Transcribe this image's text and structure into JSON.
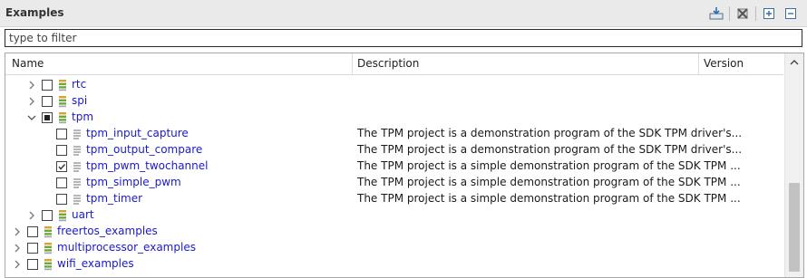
{
  "panel": {
    "title": "Examples",
    "toolbar": {
      "import_icon": "import-icon",
      "remove_icon": "remove-icon",
      "expand_all_icon": "expand-all-icon",
      "collapse_all_icon": "collapse-all-icon"
    }
  },
  "filter": {
    "placeholder": "type to filter",
    "value": ""
  },
  "columns": {
    "name": "Name",
    "description": "Description",
    "version": "Version"
  },
  "rows": [
    {
      "label": "rtc",
      "level": 2,
      "expanded": false,
      "has_children": true,
      "checked": false,
      "partial": false,
      "icon": "stack-icon",
      "description": ""
    },
    {
      "label": "spi",
      "level": 2,
      "expanded": false,
      "has_children": true,
      "checked": false,
      "partial": false,
      "icon": "stack-icon",
      "description": ""
    },
    {
      "label": "tpm",
      "level": 2,
      "expanded": true,
      "has_children": true,
      "checked": false,
      "partial": true,
      "icon": "stack-icon",
      "description": ""
    },
    {
      "label": "tpm_input_capture",
      "level": 3,
      "has_children": false,
      "checked": false,
      "partial": false,
      "icon": "document-icon",
      "description": "The TPM project is a demonstration program of the SDK TPM driver's..."
    },
    {
      "label": "tpm_output_compare",
      "level": 3,
      "has_children": false,
      "checked": false,
      "partial": false,
      "icon": "document-icon",
      "description": "The TPM project is a demonstration program of the SDK TPM driver's..."
    },
    {
      "label": "tpm_pwm_twochannel",
      "level": 3,
      "has_children": false,
      "checked": true,
      "partial": false,
      "icon": "document-icon",
      "description": "The TPM project is a simple demonstration program of the SDK TPM ..."
    },
    {
      "label": "tpm_simple_pwm",
      "level": 3,
      "has_children": false,
      "checked": false,
      "partial": false,
      "icon": "document-icon",
      "description": "The TPM project is a simple demonstration program of the SDK TPM ..."
    },
    {
      "label": "tpm_timer",
      "level": 3,
      "has_children": false,
      "checked": false,
      "partial": false,
      "icon": "document-icon",
      "description": "The TPM project is a simple demonstration program of the SDK TPM ..."
    },
    {
      "label": "uart",
      "level": 2,
      "expanded": false,
      "has_children": true,
      "checked": false,
      "partial": false,
      "icon": "stack-icon",
      "description": ""
    },
    {
      "label": "freertos_examples",
      "level": 1,
      "expanded": false,
      "has_children": true,
      "checked": false,
      "partial": false,
      "icon": "stack-icon",
      "description": ""
    },
    {
      "label": "multiprocessor_examples",
      "level": 1,
      "expanded": false,
      "has_children": true,
      "checked": false,
      "partial": false,
      "icon": "stack-icon",
      "description": ""
    },
    {
      "label": "wifi_examples",
      "level": 1,
      "expanded": false,
      "has_children": true,
      "checked": false,
      "partial": false,
      "icon": "stack-icon",
      "description": ""
    }
  ],
  "colors": {
    "link": "#1a1acc",
    "stack_green": "#6ea83a",
    "stack_orange": "#e0a030"
  }
}
